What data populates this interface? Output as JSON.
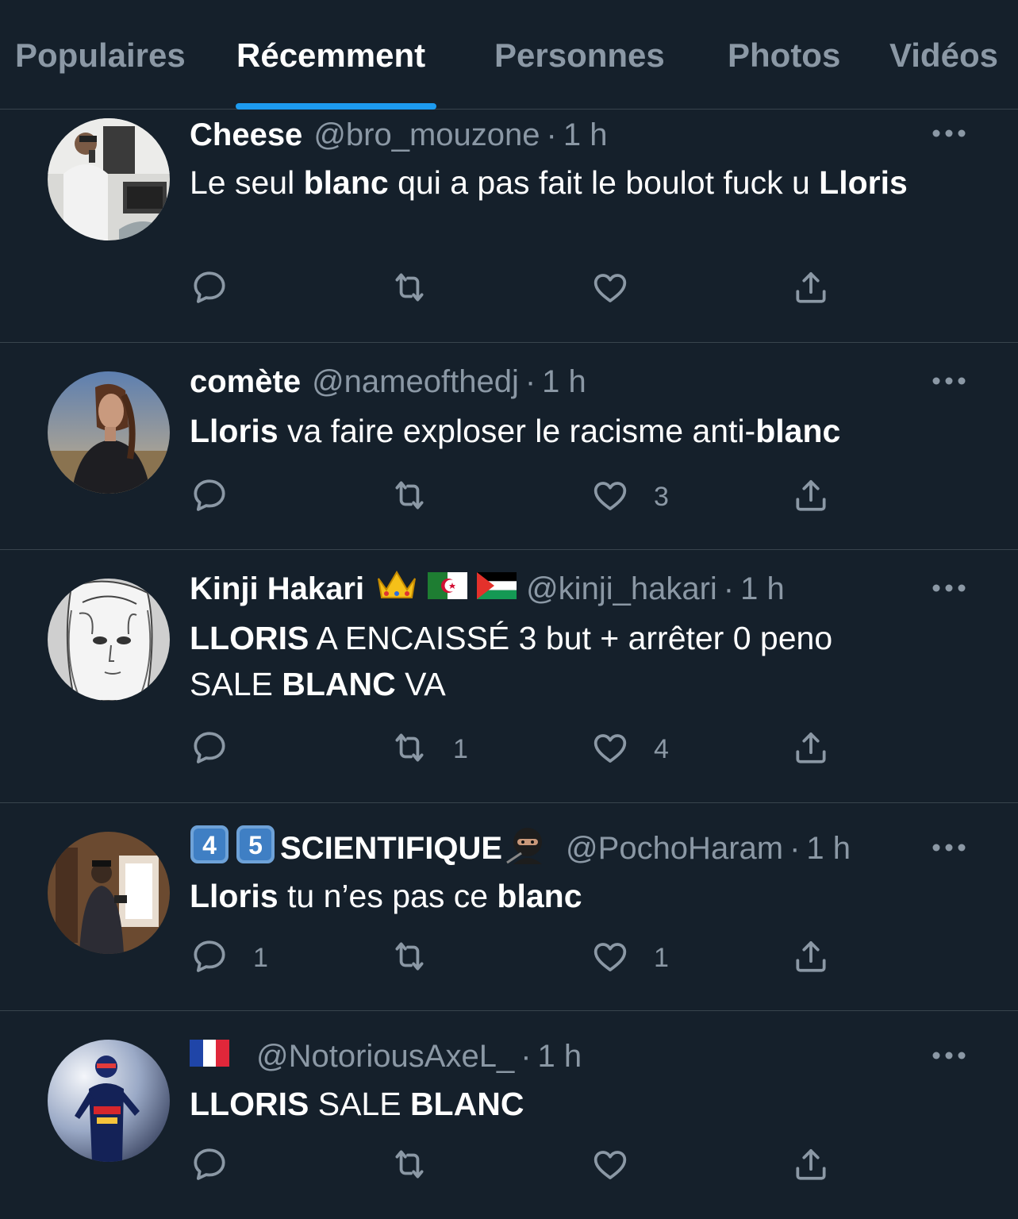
{
  "tabs": [
    {
      "label": "Populaires",
      "active": false
    },
    {
      "label": "Récemment",
      "active": true
    },
    {
      "label": "Personnes",
      "active": false
    },
    {
      "label": "Photos",
      "active": false
    },
    {
      "label": "Vidéos",
      "active": false
    }
  ],
  "colors": {
    "background": "#15202b",
    "accent": "#1d9bf0",
    "secondary_text": "#8b98a5",
    "divider": "#38444d"
  },
  "tweets": [
    {
      "display_name": "Cheese",
      "handle": "@bro_mouzone",
      "separator": "·",
      "time": "1 h",
      "body_parts": [
        {
          "text": "Le seul ",
          "bold": false
        },
        {
          "text": "blanc",
          "bold": true
        },
        {
          "text": " qui a pas fait le boulot fuck u ",
          "bold": false
        },
        {
          "text": "Lloris",
          "bold": true
        }
      ],
      "reply_count": "",
      "retweet_count": "",
      "like_count": ""
    },
    {
      "display_name": "comète",
      "handle": "@nameofthedj",
      "separator": "·",
      "time": "1 h",
      "body_parts": [
        {
          "text": "Lloris",
          "bold": true
        },
        {
          "text": " va faire exploser le racisme anti-",
          "bold": false
        },
        {
          "text": "blanc",
          "bold": true
        }
      ],
      "reply_count": "",
      "retweet_count": "",
      "like_count": "3"
    },
    {
      "display_name": "Kinji Hakari",
      "name_emojis": [
        "crown-emoji",
        "algeria-flag-emoji",
        "palestine-flag-emoji"
      ],
      "handle": "@kinji_hakari",
      "separator": "·",
      "time": "1 h",
      "body_parts": [
        {
          "text": "LLORIS",
          "bold": true
        },
        {
          "text": " A ENCAISSÉ 3 but + arrêter 0 peno SALE ",
          "bold": false
        },
        {
          "text": "BLANC",
          "bold": true
        },
        {
          "text": " VA",
          "bold": false
        }
      ],
      "reply_count": "",
      "retweet_count": "1",
      "like_count": "4"
    },
    {
      "display_name": "SCIENTIFIQUE",
      "name_prefix_keycaps": [
        "4",
        "5"
      ],
      "name_emojis": [
        "ninja-emoji"
      ],
      "handle": "@PochoHaram",
      "separator": "·",
      "time": "1 h",
      "body_parts": [
        {
          "text": "Lloris",
          "bold": true
        },
        {
          "text": " tu n’es pas ce ",
          "bold": false
        },
        {
          "text": "blanc",
          "bold": true
        }
      ],
      "reply_count": "1",
      "retweet_count": "",
      "like_count": "1"
    },
    {
      "display_name": "",
      "name_emojis": [
        "france-flag-emoji"
      ],
      "handle": "@NotoriousAxeL_",
      "separator": "·",
      "time": "1 h",
      "body_parts": [
        {
          "text": "LLORIS",
          "bold": true
        },
        {
          "text": " SALE ",
          "bold": false
        },
        {
          "text": "BLANC",
          "bold": true
        }
      ],
      "reply_count": "",
      "retweet_count": "",
      "like_count": ""
    }
  ]
}
